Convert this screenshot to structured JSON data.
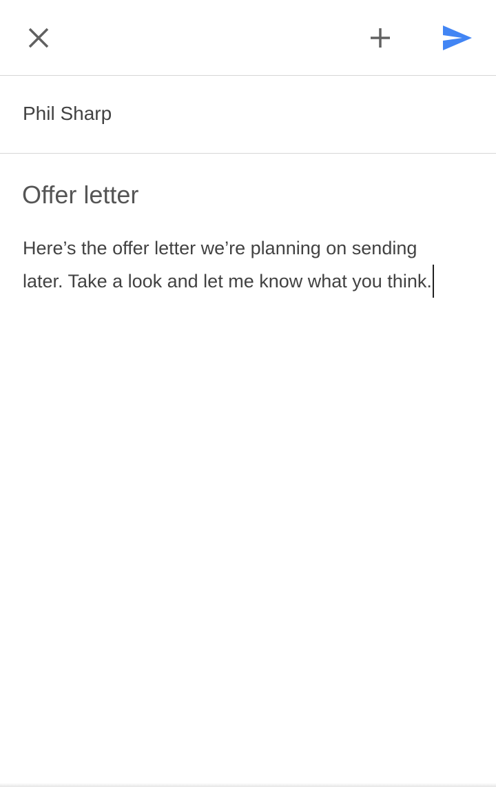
{
  "compose": {
    "to": "Phil Sharp",
    "subject": "Offer letter",
    "body_lines": [
      "Here’s the offer letter we’re planning on sending",
      "later.  Take a look and let me know what you think."
    ]
  },
  "toolbar": {
    "close_icon": "close-icon",
    "add_icon": "plus-icon",
    "send_icon": "send-icon",
    "send_color": "#4285f4",
    "icon_color": "#616161"
  }
}
